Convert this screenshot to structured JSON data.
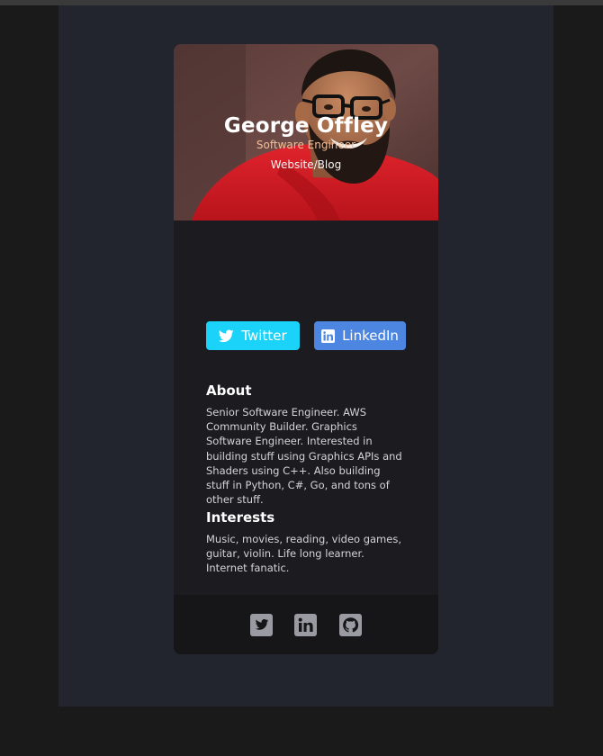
{
  "profile": {
    "name": "George Offley",
    "role": "Software Engineer",
    "website_label": "Website/Blog",
    "photo_alt": "George Offley smiling, wearing glasses and a red shirt"
  },
  "buttons": {
    "twitter_label": "Twitter",
    "linkedin_label": "LinkedIn"
  },
  "about": {
    "title": "About",
    "text": "Senior Software Engineer. AWS Community Builder. Graphics Software Engineer. Interested in building stuff using Graphics APIs and Shaders using C++. Also building stuff in Python, C#, Go, and tons of other stuff."
  },
  "interests": {
    "title": "Interests",
    "text": "Music, movies, reading, video games, guitar, violin. Life long learner. Internet fanatic."
  },
  "footer": {
    "icons": [
      "twitter-icon",
      "linkedin-icon",
      "github-icon"
    ]
  },
  "colors": {
    "twitter_button": "#1bd3f8",
    "linkedin_button": "#4c86e0",
    "role_text": "#f3bf99",
    "card_bg": "#1b1b20",
    "footer_bg": "#161619",
    "footer_icon": "#9a9aa3"
  }
}
